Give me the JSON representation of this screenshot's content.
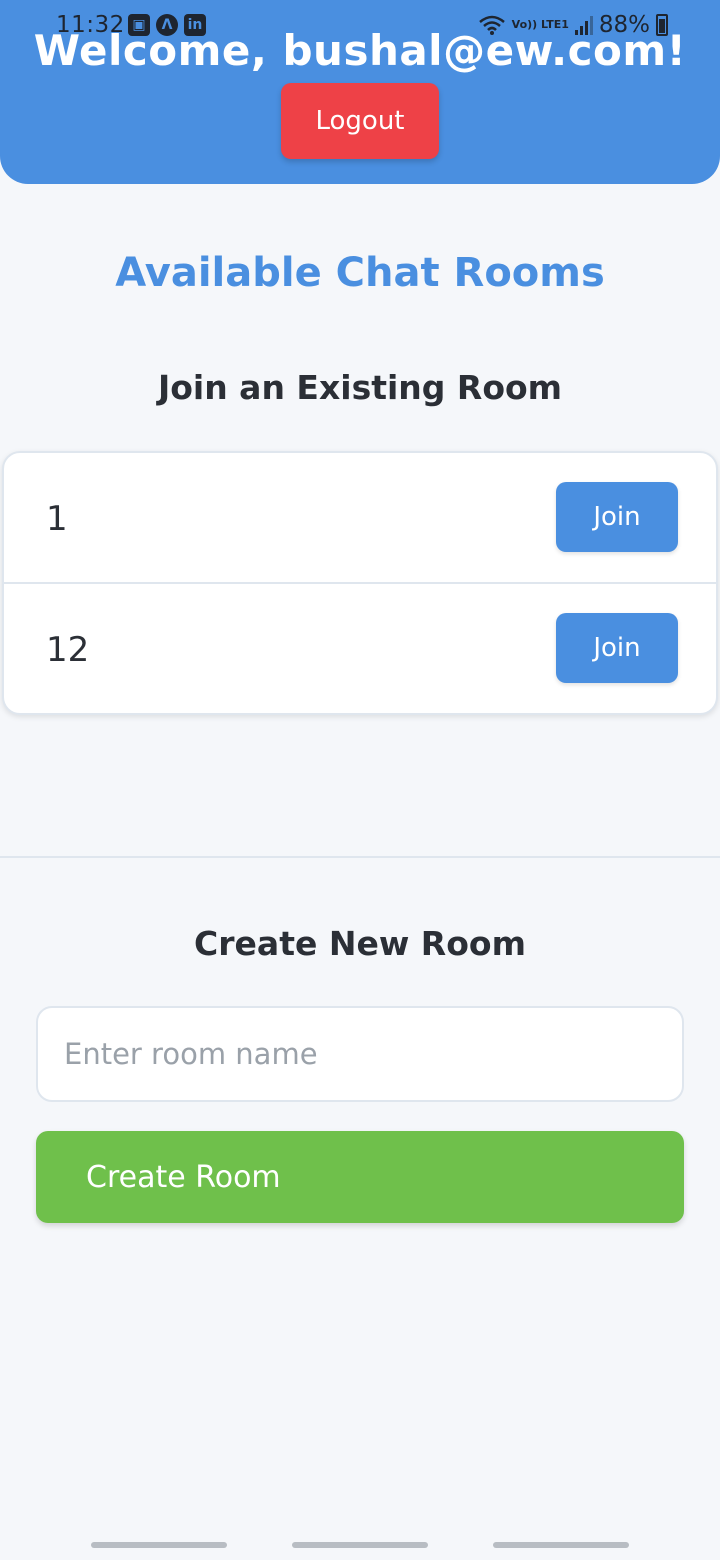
{
  "status_bar": {
    "time": "11:32",
    "left_icons": [
      "gallery-icon",
      "a-icon",
      "linkedin-icon"
    ],
    "battery_percent": "88%",
    "lte_text": "Vo)) LTE1"
  },
  "header": {
    "welcome_text": "Welcome, bushal@ew.com!",
    "logout_label": "Logout",
    "background_color": "#4a8fe0",
    "logout_color": "#ee4147"
  },
  "main": {
    "title": "Available Chat Rooms",
    "join_heading": "Join an Existing Room",
    "rooms": [
      {
        "name": "1",
        "join_label": "Join"
      },
      {
        "name": "12",
        "join_label": "Join"
      }
    ]
  },
  "create": {
    "heading": "Create New Room",
    "input_placeholder": "Enter room name",
    "input_value": "",
    "button_label": "Create Room",
    "button_color": "#6fc04b"
  }
}
